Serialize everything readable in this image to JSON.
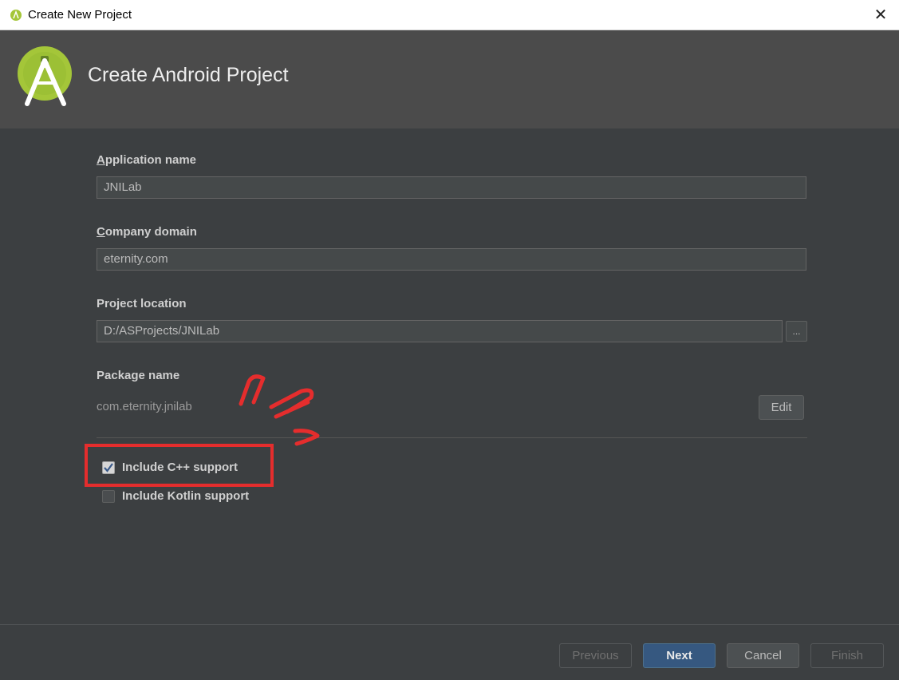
{
  "window": {
    "title": "Create New Project",
    "close_glyph": "✕"
  },
  "header": {
    "title": "Create Android Project"
  },
  "form": {
    "app_name": {
      "label_first": "A",
      "label_rest": "pplication name",
      "value": "JNILab"
    },
    "company_domain": {
      "label_first": "C",
      "label_rest": "ompany domain",
      "value": "eternity.com"
    },
    "project_location": {
      "label": "Project location",
      "value": "D:/ASProjects/JNILab",
      "browse_label": "..."
    },
    "package_name": {
      "label": "Package name",
      "value": "com.eternity.jnilab",
      "edit_label": "Edit"
    }
  },
  "options": {
    "cpp": {
      "label": "Include C++ support",
      "checked": true
    },
    "kotlin": {
      "label": "Include Kotlin support",
      "checked": false
    }
  },
  "buttons": {
    "previous": "Previous",
    "next": "Next",
    "cancel": "Cancel",
    "finish": "Finish"
  },
  "colors": {
    "accent": "#365880",
    "annotation": "#e52d2d",
    "android_green": "#a4c639"
  }
}
